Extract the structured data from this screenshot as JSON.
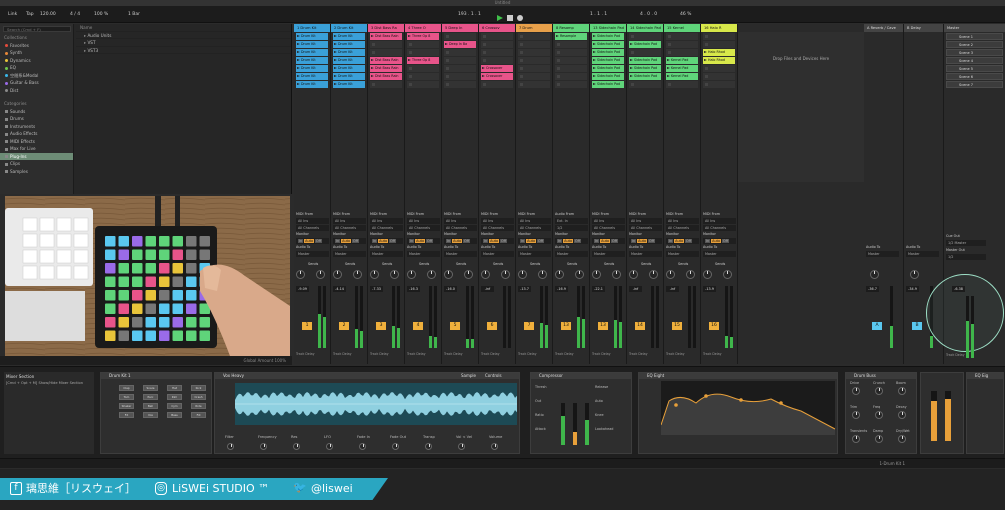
{
  "window_title": "Untitled",
  "topbar": {
    "link": "Link",
    "tap": "Tap",
    "tempo": "120.00",
    "signature": "4 / 4",
    "zoom": "100 %",
    "quantize": "1 Bar",
    "position": "193 .  1 .  1",
    "loop_end": "1 .  1 .  1",
    "loop_len": "4 .  0 .  0",
    "cpu": "46 %"
  },
  "browser": {
    "search_placeholder": "Search (Cmd + F)",
    "collections_header": "Collections",
    "collections": [
      {
        "label": "Favorites",
        "color": "#e54b3c"
      },
      {
        "label": "Synth",
        "color": "#e8883a"
      },
      {
        "label": "Dynamics",
        "color": "#e8c43a"
      },
      {
        "label": "EQ",
        "color": "#6ec74d"
      },
      {
        "label": "空間系&Modal",
        "color": "#3ab7e8"
      },
      {
        "label": "Guitar & Bass",
        "color": "#9a6be8"
      },
      {
        "label": "Dist",
        "color": "#8a8a8a"
      }
    ],
    "categories_header": "Categories",
    "categories": [
      "Sounds",
      "Drums",
      "Instruments",
      "Audio Effects",
      "MIDI Effects",
      "Max for Live",
      "Plug-Ins",
      "Clips",
      "Samples"
    ],
    "selected_category": "Plug-Ins",
    "name_header": "Name",
    "tree": [
      "Audio Units",
      "VST",
      "VST3"
    ]
  },
  "video_status": "Global Amount  100%",
  "tracks": [
    {
      "name": "1 Drum Kit",
      "color": "#3aa0d8",
      "clips": [
        "Drum Kit",
        "Drum Kit",
        "Drum Kit",
        "Drum Kit",
        "Drum Kit",
        "Drum Kit",
        "Drum Kit"
      ],
      "in_label": "MIDI From",
      "in": "All Ins",
      "ch": "All Channels",
      "num": "1",
      "vol": "-9.09",
      "meter": 0.55
    },
    {
      "name": "2 Drum Kit",
      "color": "#3aa0d8",
      "clips": [
        "Drum Kit",
        "Drum Kit",
        "Drum Kit",
        "Drum Kit",
        "Drum Kit",
        "Drum Kit",
        "Drum Kit"
      ],
      "in_label": "MIDI From",
      "in": "All Ins",
      "ch": "All Channels",
      "num": "2",
      "vol": "-4.14",
      "meter": 0.3
    },
    {
      "name": "3 Dist Bass Ra",
      "color": "#e8548a",
      "clips": [
        "Dist Bass Rain",
        "",
        "",
        "Dist Bass Rain",
        "Dist Bass Rain",
        "Dist Bass Rain",
        ""
      ],
      "in_label": "MIDI From",
      "in": "All Ins",
      "ch": "All Channels",
      "num": "3",
      "vol": "-7.33",
      "meter": 0.35
    },
    {
      "name": "4 Three O",
      "color": "#e8548a",
      "clips": [
        "Three Op 8",
        "",
        "",
        "Three Op 8",
        "",
        "",
        ""
      ],
      "in_label": "MIDI From",
      "in": "All Ins",
      "ch": "All Channels",
      "num": "4",
      "vol": "-16.3",
      "meter": 0.2
    },
    {
      "name": "5 Deep In",
      "color": "#e8548a",
      "clips": [
        "",
        "Deep In Ba",
        "",
        "",
        "",
        "",
        ""
      ],
      "in_label": "MIDI From",
      "in": "All Ins",
      "ch": "All Channels",
      "num": "5",
      "vol": "-16.0",
      "meter": 0.15
    },
    {
      "name": "6 Crossov",
      "color": "#e8548a",
      "clips": [
        "",
        "",
        "",
        "",
        "Crossover",
        "Crossover",
        ""
      ],
      "in_label": "MIDI From",
      "in": "All Ins",
      "ch": "All Channels",
      "num": "6",
      "vol": "-inf",
      "meter": 0.0
    },
    {
      "name": "7 Drum",
      "color": "#e8a04a",
      "clips": [
        "",
        "",
        "",
        "",
        "",
        "",
        ""
      ],
      "in_label": "MIDI From",
      "in": "All Ins",
      "ch": "All Channels",
      "num": "7",
      "vol": "-13.7",
      "meter": 0.4
    },
    {
      "name": "8 Resamp",
      "color": "#5fd47a",
      "clips": [
        "Resample",
        "",
        "",
        "",
        "",
        "",
        ""
      ],
      "in_label": "Audio From",
      "in": "Ext. In",
      "ch": "1/2",
      "num": "13",
      "vol": "-16.9",
      "meter": 0.5
    },
    {
      "name": "13 Sidechain Pad",
      "color": "#5fd47a",
      "clips": [
        "Sidechain Pad",
        "Sidechain Pad",
        "Sidechain Pad",
        "Sidechain Pad",
        "Sidechain Pad",
        "Sidechain Pad",
        "Sidechain Pad"
      ],
      "in_label": "MIDI From",
      "in": "All Ins",
      "ch": "All Channels",
      "num": "13",
      "vol": "-22.1",
      "meter": 0.45
    },
    {
      "name": "14 Sidechain Pad",
      "color": "#5fd47a",
      "clips": [
        "",
        "Sidechain Pad",
        "",
        "Sidechain Pad",
        "Sidechain Pad",
        "Sidechain Pad",
        ""
      ],
      "in_label": "MIDI From",
      "in": "All Ins",
      "ch": "All Channels",
      "num": "14",
      "vol": "-inf",
      "meter": 0.0
    },
    {
      "name": "15 Kernel",
      "color": "#5fd47a",
      "clips": [
        "",
        "",
        "",
        "Kernel Pad",
        "Kernel Pad",
        "Kernel Pad",
        ""
      ],
      "in_label": "MIDI From",
      "in": "All Ins",
      "ch": "All Channels",
      "num": "15",
      "vol": "-inf",
      "meter": 0.0
    },
    {
      "name": "16 Halo R",
      "color": "#d8e84a",
      "clips": [
        "",
        "",
        "Halo Rhod",
        "Halo Rhod",
        "",
        "",
        ""
      ],
      "in_label": "MIDI From",
      "in": "All Ins",
      "ch": "All Channels",
      "num": "16",
      "vol": "-13.9",
      "meter": 0.2
    }
  ],
  "drop_hint": "Drop Files and Devices Here",
  "returns": [
    {
      "name": "A Reverb / Cave",
      "vol": "-36.7",
      "num": "A"
    },
    {
      "name": "B Delay",
      "vol": "-34.9",
      "num": "B"
    }
  ],
  "master": {
    "name": "Master",
    "scenes": [
      "Scene 1",
      "Scene 2",
      "Scene 3",
      "Scene 4",
      "Scene 5",
      "Scene 6",
      "Scene 7"
    ],
    "cue_out": "Cue Out",
    "cue_val": "1/2 Master",
    "master_out": "Master Out",
    "master_val": "1/2",
    "vol": "-6.38"
  },
  "labels": {
    "audio_to": "Audio To",
    "master": "Master",
    "monitor": "Monitor",
    "in": "In",
    "auto": "Auto",
    "off": "Off",
    "sends": "Sends",
    "track_delay": "Track Delay",
    "ms": "0.00 ms"
  },
  "devices": {
    "info_title": "Mixer Section",
    "info_text": "[Cmd + Opt + M] Show/Hide Mixer Section",
    "drum_rack": "Drum Kit 1",
    "simpler": "Vox Heavy",
    "sample_tab": "Sample",
    "controls_tab": "Controls",
    "compressor": "Compressor",
    "eq": "EQ Eight",
    "drum_buss": "Drum Buss",
    "extra": "EQ Eig",
    "comp_params": [
      "Thresh",
      "Out",
      "Ratio",
      "Attack",
      "Release",
      "Auto",
      "Knee",
      "Lookahead"
    ],
    "drum_pads": [
      "Clap",
      "Snare",
      "Hat",
      "Kick",
      "Tom",
      "Perc",
      "Rim",
      "Crash",
      "Shaker",
      "Bell",
      "Cym",
      "Ride",
      "FX",
      "Vox",
      "Bass",
      "Fill"
    ],
    "buss_params": [
      "Drive",
      "Crunch",
      "Boom",
      "Trim",
      "Freq",
      "Decay",
      "Transients",
      "Damp",
      "Dry/Wet"
    ],
    "simpler_params": [
      "Filter",
      "Frequency",
      "Res",
      "LFO",
      "Fade In",
      "Fade Out",
      "Transp",
      "Vol < Vel",
      "Volume"
    ]
  },
  "statusbar": {
    "right": "1-Drum Kit 1"
  },
  "social": {
    "facebook": "璃思維［リスウェイ］",
    "instagram": "LiSWEi STUDIO ™",
    "twitter": "@liswei"
  }
}
